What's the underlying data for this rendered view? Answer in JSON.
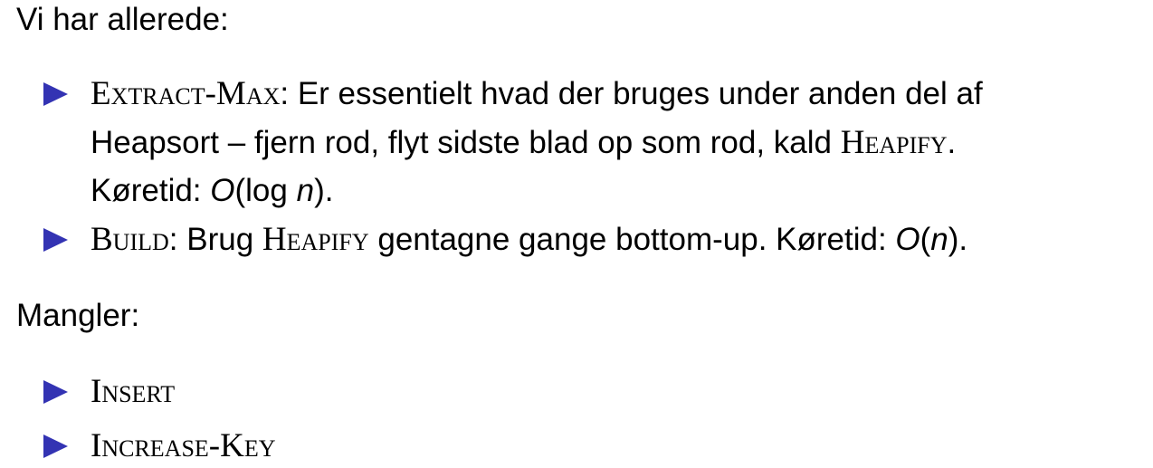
{
  "colors": {
    "bullet": "#3333b3"
  },
  "sections": [
    {
      "heading": "Vi har allerede:",
      "items": [
        {
          "lines": [
            [
              {
                "t": "Extract-Max",
                "s": "sc"
              },
              {
                "t": ": Er essentielt hvad der bruges under anden del af"
              }
            ],
            [
              {
                "t": "Heapsort – fjern rod, flyt sidste blad op som rod, kald "
              },
              {
                "t": "Heapify",
                "s": "sc"
              },
              {
                "t": "."
              }
            ],
            [
              {
                "t": "Køretid:  "
              },
              {
                "t": "O",
                "s": "it"
              },
              {
                "t": "(log "
              },
              {
                "t": "n",
                "s": "it"
              },
              {
                "t": ")."
              }
            ]
          ]
        },
        {
          "lines": [
            [
              {
                "t": "Build",
                "s": "sc"
              },
              {
                "t": ": Brug "
              },
              {
                "t": "Heapify",
                "s": "sc"
              },
              {
                "t": " gentagne gange bottom-up. Køretid:  "
              },
              {
                "t": "O",
                "s": "it"
              },
              {
                "t": "("
              },
              {
                "t": "n",
                "s": "it"
              },
              {
                "t": ")."
              }
            ]
          ]
        }
      ]
    },
    {
      "heading": "Mangler:",
      "items": [
        {
          "lines": [
            [
              {
                "t": "Insert",
                "s": "sc"
              }
            ]
          ]
        },
        {
          "lines": [
            [
              {
                "t": "Increase-Key",
                "s": "sc"
              }
            ]
          ]
        }
      ]
    }
  ]
}
